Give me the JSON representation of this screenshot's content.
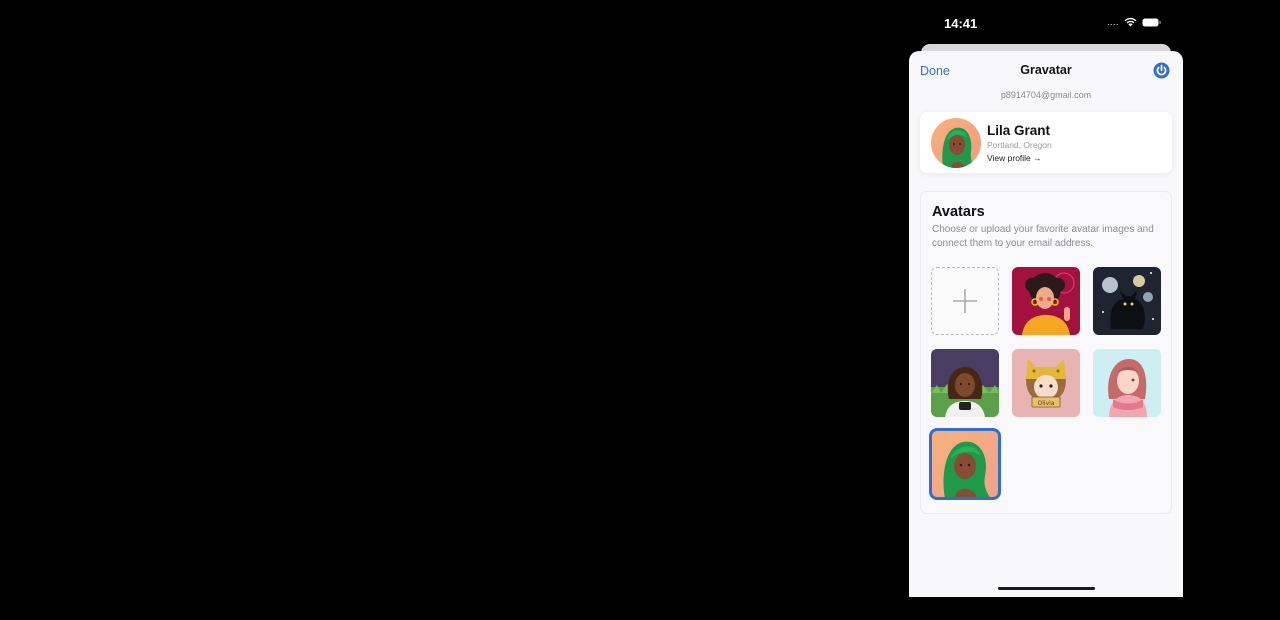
{
  "status_bar": {
    "time": "14:41",
    "signal": "....",
    "colors": {
      "foreground": "#ffffff"
    }
  },
  "nav": {
    "done_label": "Done",
    "title": "Gravatar",
    "power_icon": "power-icon",
    "accent": "#2f6fd3"
  },
  "account": {
    "email": "p8914704@gmail.com"
  },
  "profile": {
    "name": "Lila Grant",
    "location": "Portland, Oregon",
    "view_profile": "View profile →"
  },
  "avatars": {
    "title": "Avatars",
    "description": "Choose or upload your favorite avatar images and connect them to your email address.",
    "add_icon": "plus-icon",
    "items": [
      {
        "name": "curly-hair-woman"
      },
      {
        "name": "black-cat-moons"
      },
      {
        "name": "woman-in-grass"
      },
      {
        "name": "girl-cat-hat",
        "caption": "Olivia"
      },
      {
        "name": "pink-hair-scarf"
      },
      {
        "name": "green-hair-woman",
        "selected": true
      }
    ]
  }
}
